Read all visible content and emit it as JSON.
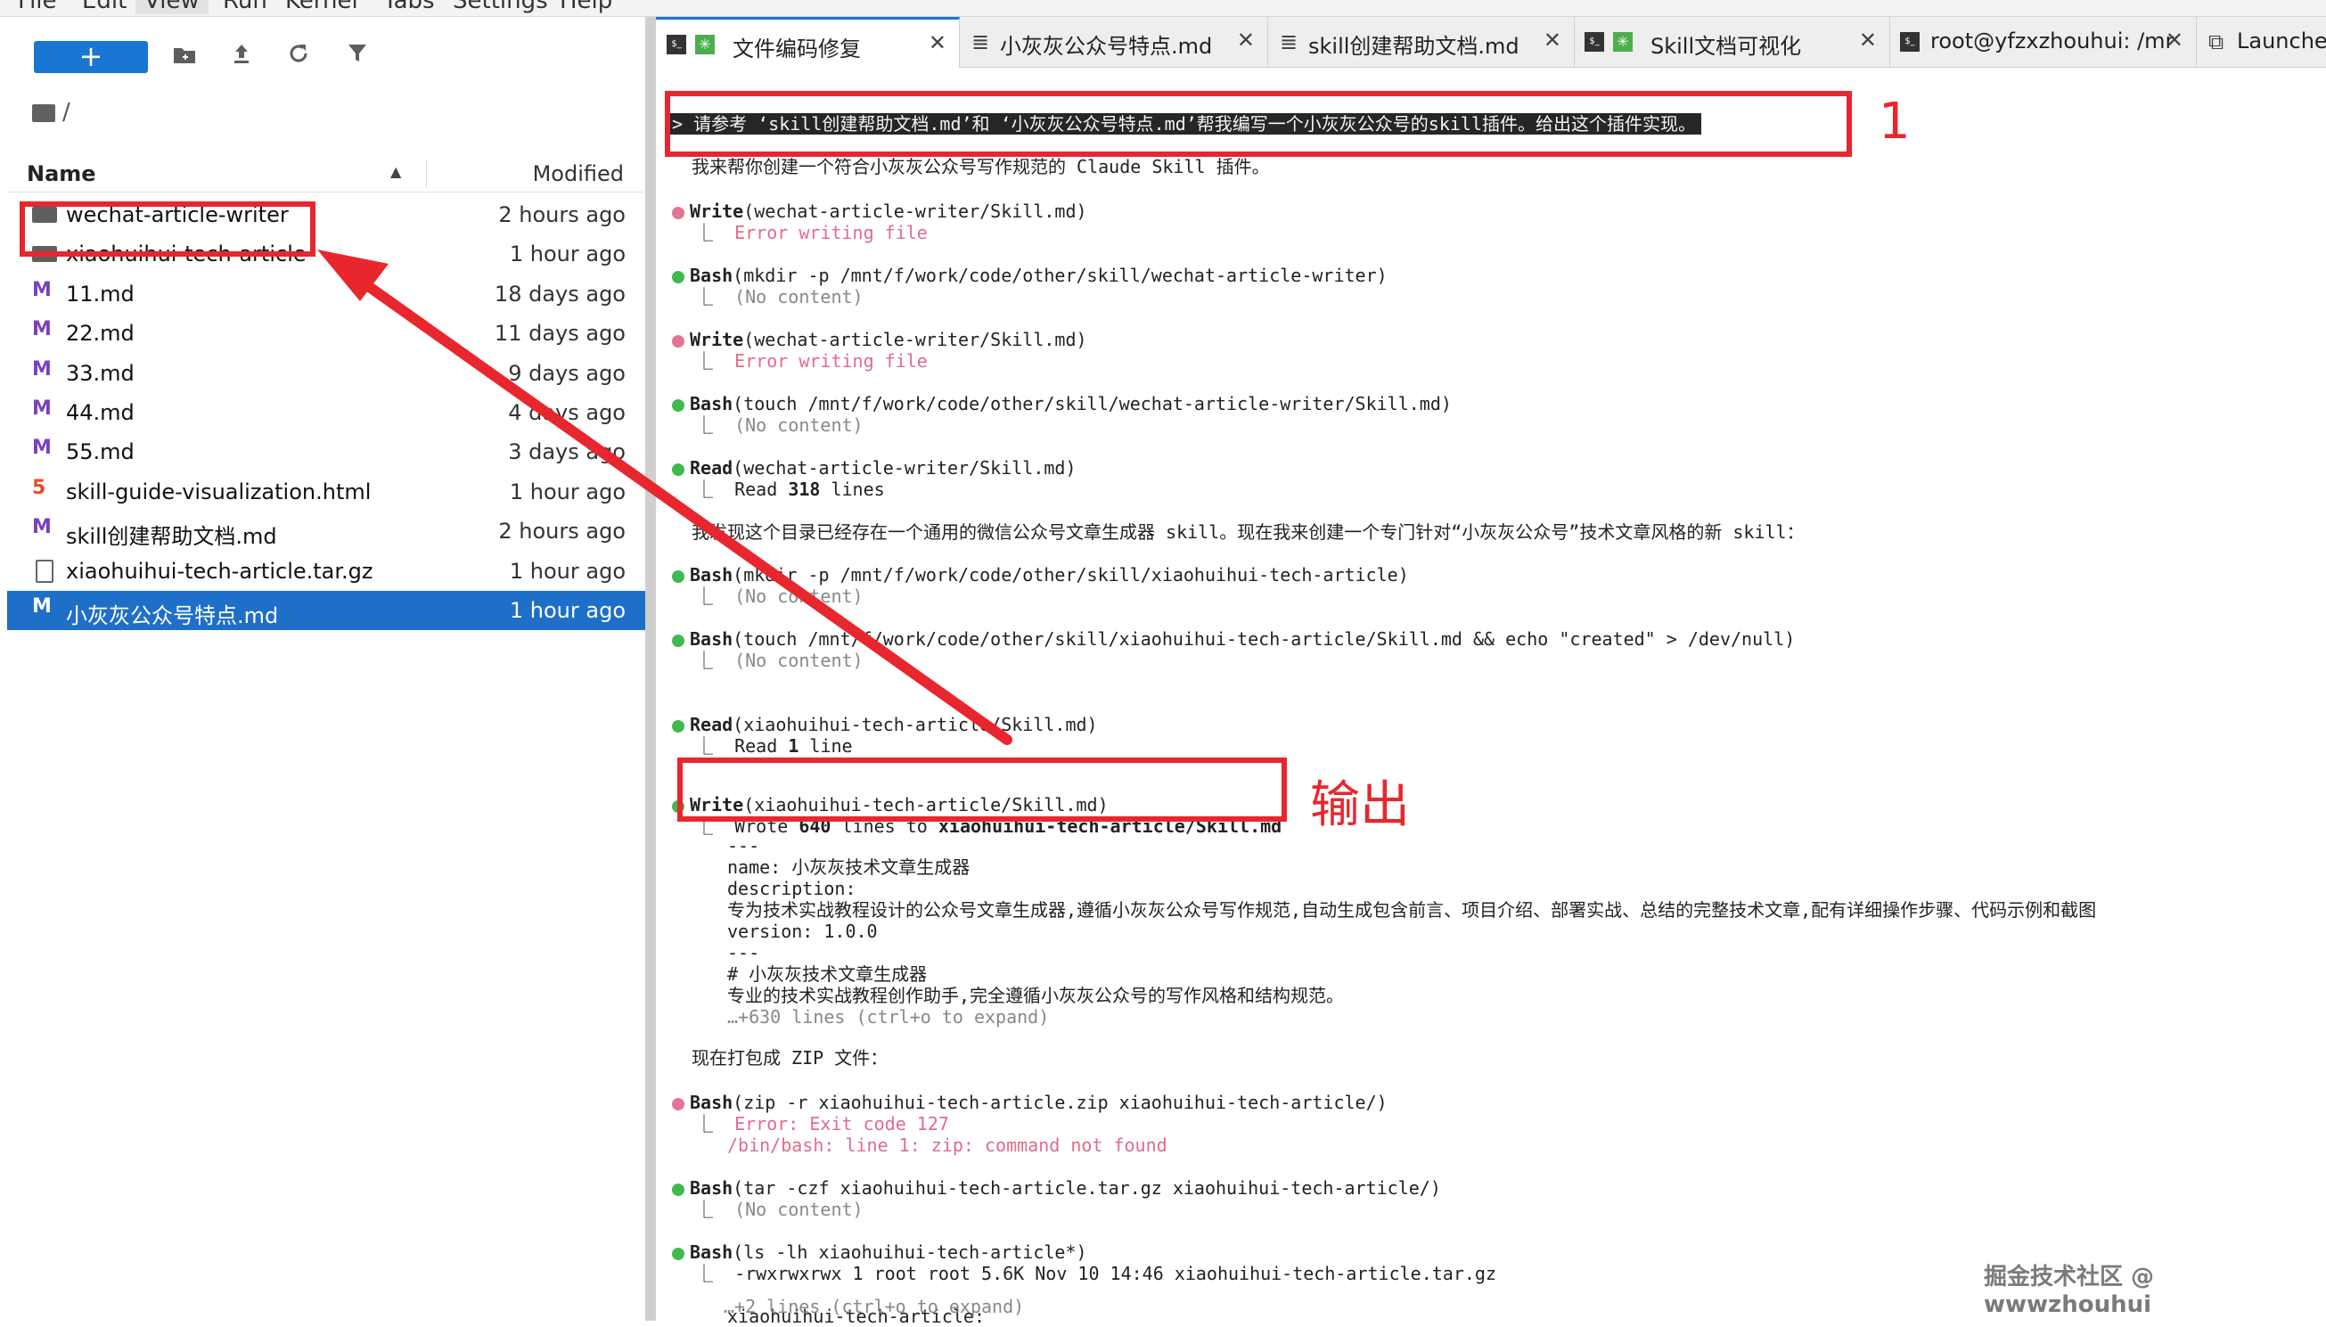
{
  "menu": [
    "File",
    "Edit",
    "View",
    "Run",
    "Kernel",
    "Tabs",
    "Settings",
    "Help"
  ],
  "toolbar": {
    "new_label": "+"
  },
  "breadcrumb": "/",
  "filebrowser": {
    "col_name": "Name",
    "col_modified": "Modified",
    "rows": [
      {
        "name": "wechat-article-writer",
        "time": "2 hours ago",
        "icon": "folder-icon"
      },
      {
        "name": "xiaohuihui-tech-article",
        "time": "1 hour ago",
        "icon": "folder-icon"
      },
      {
        "name": "11.md",
        "time": "18 days ago",
        "icon": "markdown-icon"
      },
      {
        "name": "22.md",
        "time": "11 days ago",
        "icon": "markdown-icon"
      },
      {
        "name": "33.md",
        "time": "9 days ago",
        "icon": "markdown-icon"
      },
      {
        "name": "44.md",
        "time": "4 days ago",
        "icon": "markdown-icon"
      },
      {
        "name": "55.md",
        "time": "3 days ago",
        "icon": "markdown-icon"
      },
      {
        "name": "skill-guide-visualization.html",
        "time": "1 hour ago",
        "icon": "html-icon"
      },
      {
        "name": "skill创建帮助文档.md",
        "time": "2 hours ago",
        "icon": "markdown-icon"
      },
      {
        "name": "xiaohuihui-tech-article.tar.gz",
        "time": "1 hour ago",
        "icon": "file-icon"
      },
      {
        "name": "小灰灰公众号特点.md",
        "time": "1 hour ago",
        "icon": "markdown-icon"
      }
    ]
  },
  "tabs": [
    {
      "label": "文件编码修复"
    },
    {
      "label": "小灰灰公众号特点.md"
    },
    {
      "label": "skill创建帮助文档.md"
    },
    {
      "label": "Skill文档可视化"
    },
    {
      "label": "root@yfzxzhouhui: /mr"
    },
    {
      "label": "Launcher"
    }
  ],
  "terminal": {
    "prompt": "> 请参考 ‘skill创建帮助文档.md’和 ‘小灰灰公众号特点.md’帮我编写一个小灰灰公众号的skill插件。给出这个插件实现。",
    "reply1": "我来帮你创建一个符合小灰灰公众号写作规范的 Claude Skill 插件。",
    "t1_tool": "Write",
    "t1_args": "(wechat-article-writer/Skill.md)",
    "t1_out": "Error writing file",
    "t2_tool": "Bash",
    "t2_args": "(mkdir -p /mnt/f/work/code/other/skill/wechat-article-writer)",
    "t2_out": "(No content)",
    "t3_tool": "Write",
    "t3_args": "(wechat-article-writer/Skill.md)",
    "t3_out": "Error writing file",
    "t4_tool": "Bash",
    "t4_args": "(touch /mnt/f/work/code/other/skill/wechat-article-writer/Skill.md)",
    "t4_out": "(No content)",
    "t5_tool": "Read",
    "t5_args": "(wechat-article-writer/Skill.md)",
    "t5_out_a": "Read ",
    "t5_out_b": "318",
    "t5_out_c": " lines",
    "reply2": "我发现这个目录已经存在一个通用的微信公众号文章生成器 skill。现在我来创建一个专门针对“小灰灰公众号”技术文章风格的新 skill：",
    "t6_tool": "Bash",
    "t6_args": "(mkdir -p /mnt/f/work/code/other/skill/xiaohuihui-tech-article)",
    "t6_out": "(No content)",
    "t7_tool": "Bash",
    "t7_args": "(touch /mnt/f/work/code/other/skill/xiaohuihui-tech-article/Skill.md && echo \"created\" > /dev/null)",
    "t7_out": "(No content)",
    "t8_tool": "Read",
    "t8_args": "(xiaohuihui-tech-article/Skill.md)",
    "t8_out_a": "Read ",
    "t8_out_b": "1",
    "t8_out_c": " line",
    "t9_tool": "Write",
    "t9_args": "(xiaohuihui-tech-article/Skill.md)",
    "t9_out_a": "Wrote ",
    "t9_out_b": "640",
    "t9_out_c": " lines to ",
    "t9_out_d": "xiaohuihui-tech-article/Skill.md",
    "f_sep1": "---",
    "f_name": "name: 小灰灰技术文章生成器",
    "f_desc": "description:",
    "f_desc_text": "专为技术实战教程设计的公众号文章生成器,遵循小灰灰公众号写作规范,自动生成包含前言、项目介绍、部署实战、总结的完整技术文章,配有详细操作步骤、代码示例和截图",
    "f_version": "version: 1.0.0",
    "f_sep2": "---",
    "f_h1": "# 小灰灰技术文章生成器",
    "f_p": "专业的技术实战教程创作助手,完全遵循小灰灰公众号的写作风格和结构规范。",
    "f_more": "…+630 lines (ctrl+o to expand)",
    "reply3": "现在打包成 ZIP 文件：",
    "t10_tool": "Bash",
    "t10_args": "(zip -r xiaohuihui-tech-article.zip xiaohuihui-tech-article/)",
    "t10_err1": "Error: Exit code 127",
    "t10_err2": "/bin/bash: line 1: zip: command not found",
    "t11_tool": "Bash",
    "t11_args": "(tar -czf xiaohuihui-tech-article.tar.gz xiaohuihui-tech-article/)",
    "t11_out": "(No content)",
    "t12_tool": "Bash",
    "t12_args": "(ls -lh xiaohuihui-tech-article*)",
    "t12_out1": "-rwxrwxrwx 1 root root 5.6K Nov 10 14:46 xiaohuihui-tech-article.tar.gz",
    "t12_out2": "xiaohuihui-tech-article:",
    "t12_more": "…+2 lines (ctrl+o to expand)"
  },
  "annotations": {
    "one": "1",
    "output": "输出"
  },
  "watermark": "掘金技术社区 @ wwwzhouhui",
  "colors": {
    "annotation_red": "#e8262d",
    "selection_blue": "#1e6fc7",
    "accent": "#1976d2"
  }
}
